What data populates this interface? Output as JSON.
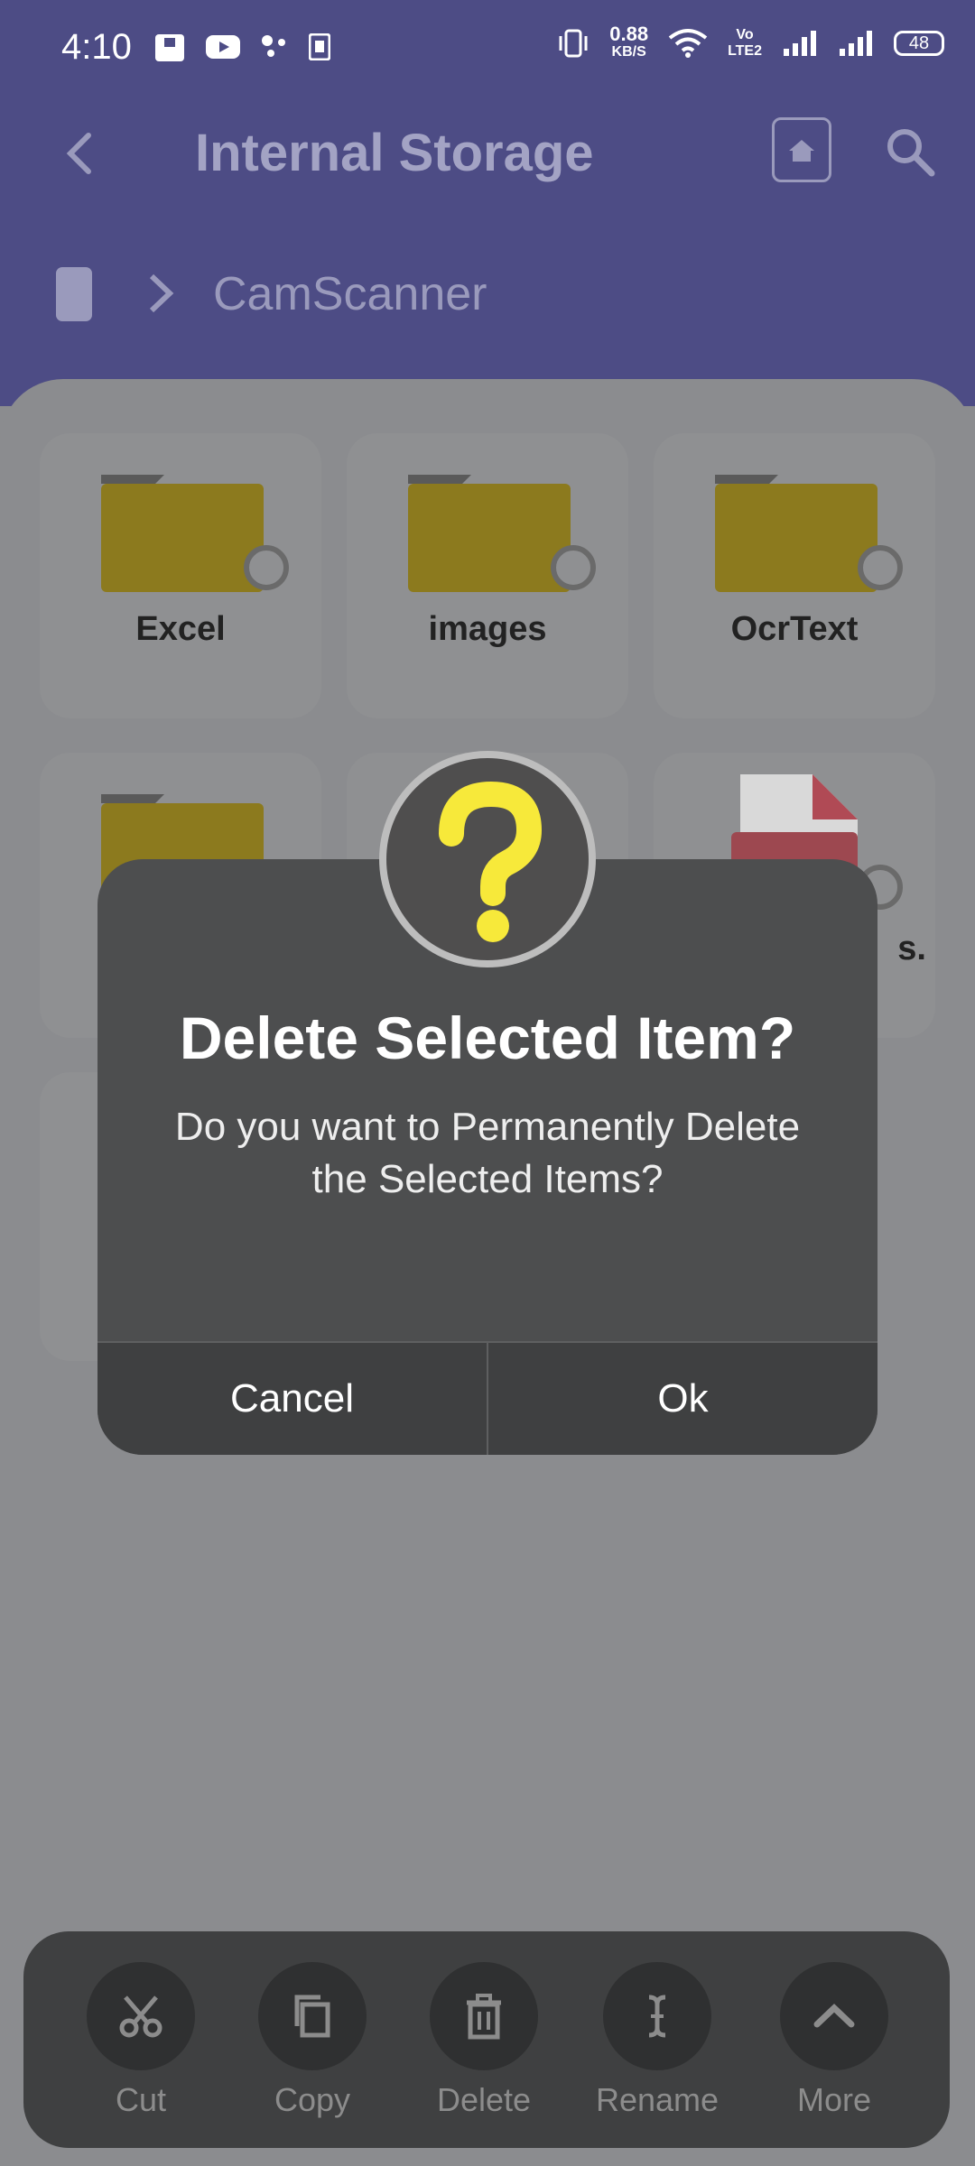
{
  "status_bar": {
    "time": "4:10",
    "network_speed": "0.88",
    "network_unit": "KB/S",
    "volte_top": "Vo",
    "volte_bottom": "LTE2",
    "battery": "48"
  },
  "app_bar": {
    "title": "Internal Storage",
    "breadcrumb": "CamScanner"
  },
  "grid_items": [
    {
      "name": "Excel",
      "type": "folder"
    },
    {
      "name": "images",
      "type": "folder"
    },
    {
      "name": "OcrText",
      "type": "folder"
    },
    {
      "name": "",
      "type": "folder"
    },
    {
      "name": "",
      "type": "folder"
    },
    {
      "name": "s.",
      "type": "pdf"
    }
  ],
  "dialog": {
    "title": "Delete Selected Item?",
    "message": "Do you want to Permanently Delete the Selected Items?",
    "cancel_label": "Cancel",
    "ok_label": "Ok",
    "icon": "question-icon",
    "icon_color": "#f7e93a"
  },
  "toolbar": {
    "items": [
      {
        "label": "Cut",
        "icon": "scissors-icon"
      },
      {
        "label": "Copy",
        "icon": "copy-icon"
      },
      {
        "label": "Delete",
        "icon": "trash-icon"
      },
      {
        "label": "Rename",
        "icon": "text-cursor-icon"
      },
      {
        "label": "More",
        "icon": "chevron-up-icon"
      }
    ]
  },
  "colors": {
    "app_bar": "#4d4c85",
    "dim_overlay": "#8b8c8f",
    "dialog_bg": "#4d4e4f",
    "folder": "#8c7a1e"
  }
}
